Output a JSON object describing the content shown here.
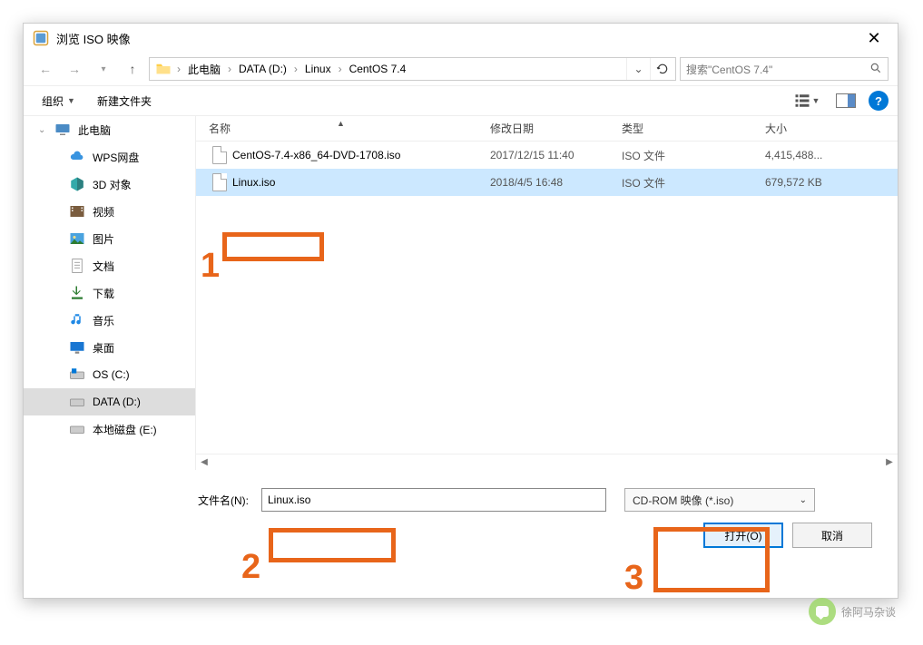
{
  "title": "浏览 ISO 映像",
  "breadcrumb": [
    "此电脑",
    "DATA (D:)",
    "Linux",
    "CentOS 7.4"
  ],
  "search_placeholder": "搜索\"CentOS 7.4\"",
  "toolbar": {
    "organize": "组织",
    "newfolder": "新建文件夹"
  },
  "columns": {
    "name": "名称",
    "date": "修改日期",
    "type": "类型",
    "size": "大小"
  },
  "sidebar": [
    {
      "label": "此电脑",
      "icon": "pc"
    },
    {
      "label": "WPS网盘",
      "icon": "cloud"
    },
    {
      "label": "3D 对象",
      "icon": "3d"
    },
    {
      "label": "视频",
      "icon": "video"
    },
    {
      "label": "图片",
      "icon": "pictures"
    },
    {
      "label": "文档",
      "icon": "docs"
    },
    {
      "label": "下载",
      "icon": "download"
    },
    {
      "label": "音乐",
      "icon": "music"
    },
    {
      "label": "桌面",
      "icon": "desktop"
    },
    {
      "label": "OS (C:)",
      "icon": "drive-win"
    },
    {
      "label": "DATA (D:)",
      "icon": "drive",
      "selected": true
    },
    {
      "label": "本地磁盘 (E:)",
      "icon": "drive"
    }
  ],
  "files": [
    {
      "name": "CentOS-7.4-x86_64-DVD-1708.iso",
      "date": "2017/12/15 11:40",
      "type": "ISO 文件",
      "size": "4,415,488..."
    },
    {
      "name": "Linux.iso",
      "date": "2018/4/5 16:48",
      "type": "ISO 文件",
      "size": "679,572 KB",
      "selected": true
    }
  ],
  "filename_label": "文件名(N):",
  "filename_value": "Linux.iso",
  "filetype_value": "CD-ROM 映像 (*.iso)",
  "open_label": "打开(O)",
  "cancel_label": "取消",
  "annotations": {
    "n1": "1",
    "n2": "2",
    "n3": "3"
  },
  "watermark_text": "徐阿马杂谈"
}
